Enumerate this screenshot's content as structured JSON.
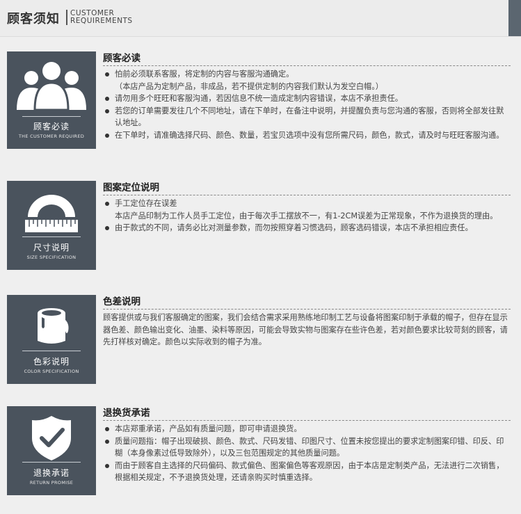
{
  "header": {
    "title_cn": "顾客须知",
    "title_en_line1": "CUSTOMER",
    "title_en_line2": "REQUIREMENTS"
  },
  "sections": [
    {
      "badge_cn": "顾客必读",
      "badge_en": "THE CUSTOMER REQUIRED",
      "icon": "people-group-icon",
      "heading": "顾客必读",
      "items": [
        {
          "bullet": true,
          "text": "怕前必须联系客服，将定制的内容与客服沟通确定。"
        },
        {
          "bullet": false,
          "text": "（本店产品为定制产品，非成品，若不提供定制的内容我们默认为发空白帽。）"
        },
        {
          "bullet": true,
          "text": "请勿用多个旺旺和客服沟通，若因信息不统一造成定制内容错误，本店不承担责任。"
        },
        {
          "bullet": true,
          "text": "若您的订单需要发往几个不同地址，请在下单时，在备注中说明，并提醒负责与您沟通的客服，否则将全部发往默认地址。"
        },
        {
          "bullet": true,
          "text": "在下单时，请准确选择尺码、颜色、数量，若宝贝选项中没有您所需尺码，颜色，款式，请及时与旺旺客服沟通。"
        }
      ]
    },
    {
      "badge_cn": "尺寸说明",
      "badge_en": "SIZE SPECIFICATION",
      "icon": "protractor-ruler-icon",
      "heading": "图案定位说明",
      "items": [
        {
          "bullet": true,
          "text": "手工定位存在误差"
        },
        {
          "bullet": false,
          "text": "本店产品印制为工作人员手工定位，由于每次手工摆放不一，有1-2CM误差为正常现象，不作为退换货的理由。"
        },
        {
          "bullet": true,
          "text": "由于款式的不同，请务必比对测量参数，而勿按照穿着习惯选码，顾客选码错误，本店不承担相应责任。"
        }
      ]
    },
    {
      "badge_cn": "色彩说明",
      "badge_en": "COLOR SPECIFICATION",
      "icon": "paint-bucket-icon",
      "heading": "色差说明",
      "paragraph": "顾客提供或与我们客服确定的图案，我们会结合需求采用熟练地印制工艺与设备将图案印制于承载的帽子，但存在显示器色差、颜色输出变化、油墨、染料等原因，可能会导致实物与图案存在些许色差，若对颜色要求比较苛刻的顾客，请先打样核对确定。颜色以实际收到的帽子为准。"
    },
    {
      "badge_cn": "退换承诺",
      "badge_en": "RETURN PROMISE",
      "icon": "shield-check-icon",
      "heading": "退换货承诺",
      "items": [
        {
          "bullet": true,
          "text": "本店郑重承诺，产品如有质量问题，即可申请退换货。"
        },
        {
          "bullet": true,
          "text": "质量问题指：帽子出现破损、颜色、款式、尺码发错、印图尺寸、位置未按您提出的要求定制图案印错、印反、印糊（本身像素过低导致除外），以及三包范围规定的其他质量问题。"
        },
        {
          "bullet": true,
          "text": "而由于顾客自主选择的尺码偏码、款式偏色、图案偏色等客观原因，由于本店是定制类产品，无法进行二次销售，根据相关规定，不予退换货处理，还请亲购买时慎重选择。"
        }
      ]
    }
  ]
}
